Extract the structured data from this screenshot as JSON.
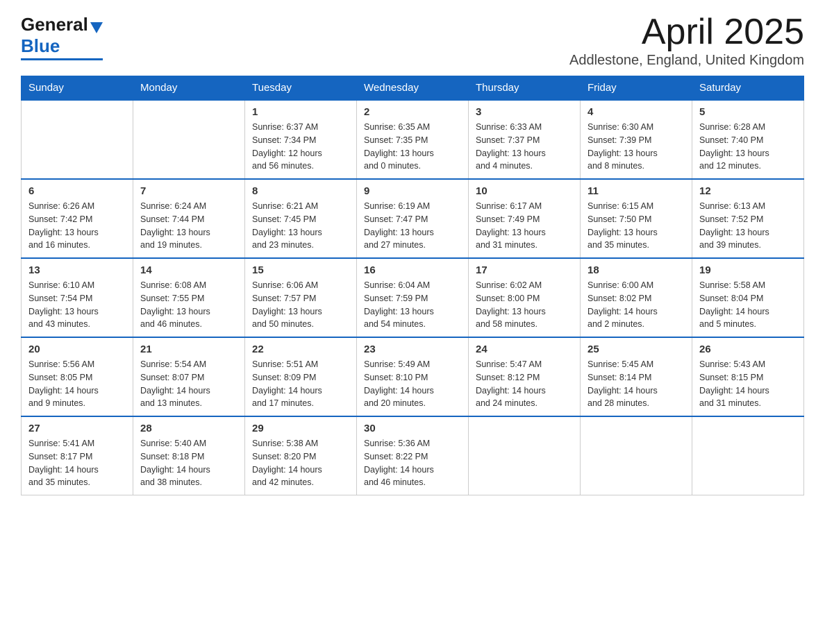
{
  "header": {
    "logo_general": "General",
    "logo_blue": "Blue",
    "month_title": "April 2025",
    "location": "Addlestone, England, United Kingdom"
  },
  "days_of_week": [
    "Sunday",
    "Monday",
    "Tuesday",
    "Wednesday",
    "Thursday",
    "Friday",
    "Saturday"
  ],
  "weeks": [
    [
      {
        "day": "",
        "info": ""
      },
      {
        "day": "",
        "info": ""
      },
      {
        "day": "1",
        "info": "Sunrise: 6:37 AM\nSunset: 7:34 PM\nDaylight: 12 hours\nand 56 minutes."
      },
      {
        "day": "2",
        "info": "Sunrise: 6:35 AM\nSunset: 7:35 PM\nDaylight: 13 hours\nand 0 minutes."
      },
      {
        "day": "3",
        "info": "Sunrise: 6:33 AM\nSunset: 7:37 PM\nDaylight: 13 hours\nand 4 minutes."
      },
      {
        "day": "4",
        "info": "Sunrise: 6:30 AM\nSunset: 7:39 PM\nDaylight: 13 hours\nand 8 minutes."
      },
      {
        "day": "5",
        "info": "Sunrise: 6:28 AM\nSunset: 7:40 PM\nDaylight: 13 hours\nand 12 minutes."
      }
    ],
    [
      {
        "day": "6",
        "info": "Sunrise: 6:26 AM\nSunset: 7:42 PM\nDaylight: 13 hours\nand 16 minutes."
      },
      {
        "day": "7",
        "info": "Sunrise: 6:24 AM\nSunset: 7:44 PM\nDaylight: 13 hours\nand 19 minutes."
      },
      {
        "day": "8",
        "info": "Sunrise: 6:21 AM\nSunset: 7:45 PM\nDaylight: 13 hours\nand 23 minutes."
      },
      {
        "day": "9",
        "info": "Sunrise: 6:19 AM\nSunset: 7:47 PM\nDaylight: 13 hours\nand 27 minutes."
      },
      {
        "day": "10",
        "info": "Sunrise: 6:17 AM\nSunset: 7:49 PM\nDaylight: 13 hours\nand 31 minutes."
      },
      {
        "day": "11",
        "info": "Sunrise: 6:15 AM\nSunset: 7:50 PM\nDaylight: 13 hours\nand 35 minutes."
      },
      {
        "day": "12",
        "info": "Sunrise: 6:13 AM\nSunset: 7:52 PM\nDaylight: 13 hours\nand 39 minutes."
      }
    ],
    [
      {
        "day": "13",
        "info": "Sunrise: 6:10 AM\nSunset: 7:54 PM\nDaylight: 13 hours\nand 43 minutes."
      },
      {
        "day": "14",
        "info": "Sunrise: 6:08 AM\nSunset: 7:55 PM\nDaylight: 13 hours\nand 46 minutes."
      },
      {
        "day": "15",
        "info": "Sunrise: 6:06 AM\nSunset: 7:57 PM\nDaylight: 13 hours\nand 50 minutes."
      },
      {
        "day": "16",
        "info": "Sunrise: 6:04 AM\nSunset: 7:59 PM\nDaylight: 13 hours\nand 54 minutes."
      },
      {
        "day": "17",
        "info": "Sunrise: 6:02 AM\nSunset: 8:00 PM\nDaylight: 13 hours\nand 58 minutes."
      },
      {
        "day": "18",
        "info": "Sunrise: 6:00 AM\nSunset: 8:02 PM\nDaylight: 14 hours\nand 2 minutes."
      },
      {
        "day": "19",
        "info": "Sunrise: 5:58 AM\nSunset: 8:04 PM\nDaylight: 14 hours\nand 5 minutes."
      }
    ],
    [
      {
        "day": "20",
        "info": "Sunrise: 5:56 AM\nSunset: 8:05 PM\nDaylight: 14 hours\nand 9 minutes."
      },
      {
        "day": "21",
        "info": "Sunrise: 5:54 AM\nSunset: 8:07 PM\nDaylight: 14 hours\nand 13 minutes."
      },
      {
        "day": "22",
        "info": "Sunrise: 5:51 AM\nSunset: 8:09 PM\nDaylight: 14 hours\nand 17 minutes."
      },
      {
        "day": "23",
        "info": "Sunrise: 5:49 AM\nSunset: 8:10 PM\nDaylight: 14 hours\nand 20 minutes."
      },
      {
        "day": "24",
        "info": "Sunrise: 5:47 AM\nSunset: 8:12 PM\nDaylight: 14 hours\nand 24 minutes."
      },
      {
        "day": "25",
        "info": "Sunrise: 5:45 AM\nSunset: 8:14 PM\nDaylight: 14 hours\nand 28 minutes."
      },
      {
        "day": "26",
        "info": "Sunrise: 5:43 AM\nSunset: 8:15 PM\nDaylight: 14 hours\nand 31 minutes."
      }
    ],
    [
      {
        "day": "27",
        "info": "Sunrise: 5:41 AM\nSunset: 8:17 PM\nDaylight: 14 hours\nand 35 minutes."
      },
      {
        "day": "28",
        "info": "Sunrise: 5:40 AM\nSunset: 8:18 PM\nDaylight: 14 hours\nand 38 minutes."
      },
      {
        "day": "29",
        "info": "Sunrise: 5:38 AM\nSunset: 8:20 PM\nDaylight: 14 hours\nand 42 minutes."
      },
      {
        "day": "30",
        "info": "Sunrise: 5:36 AM\nSunset: 8:22 PM\nDaylight: 14 hours\nand 46 minutes."
      },
      {
        "day": "",
        "info": ""
      },
      {
        "day": "",
        "info": ""
      },
      {
        "day": "",
        "info": ""
      }
    ]
  ]
}
